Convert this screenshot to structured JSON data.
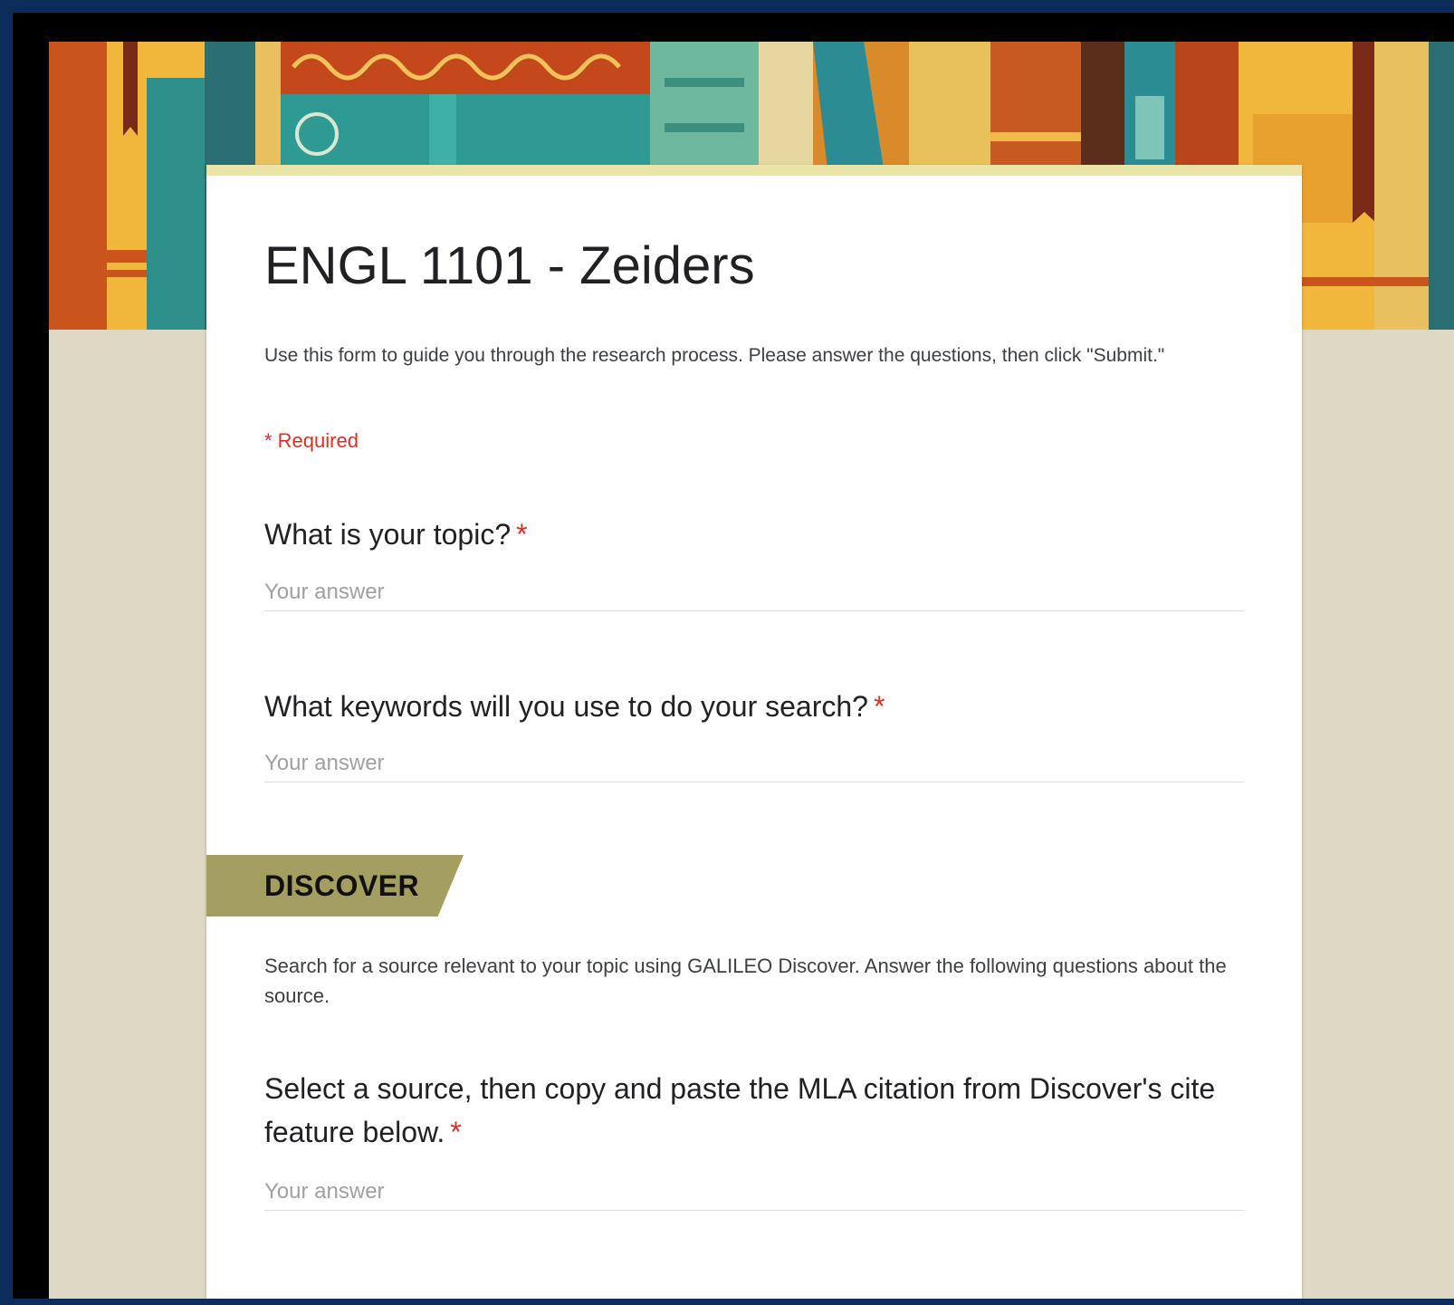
{
  "form": {
    "title": "ENGL 1101 - Zeiders",
    "description": "Use this form to guide you through the research process. Please answer the questions, then click \"Submit.\"",
    "required_note": "* Required"
  },
  "questions": [
    {
      "label": "What is your topic?",
      "required_marker": "*",
      "placeholder": "Your answer"
    },
    {
      "label": "What keywords will you use to do your search?",
      "required_marker": "*",
      "placeholder": "Your answer"
    }
  ],
  "section": {
    "title": "DISCOVER",
    "description": "Search for a source relevant to your topic using GALILEO Discover. Answer the following questions about the source.",
    "questions": [
      {
        "label": "Select a source, then copy and paste the MLA citation from Discover's cite feature below.",
        "required_marker": "*",
        "placeholder": "Your answer"
      }
    ]
  },
  "colors": {
    "page_background": "#ddd9c4",
    "card_accent": "#ebe4a7",
    "section_tab": "#a59e61",
    "required": "#d93025",
    "outer_frame": "#0b2d5c"
  },
  "header_image": {
    "icon": "bookshelf-illustration"
  }
}
